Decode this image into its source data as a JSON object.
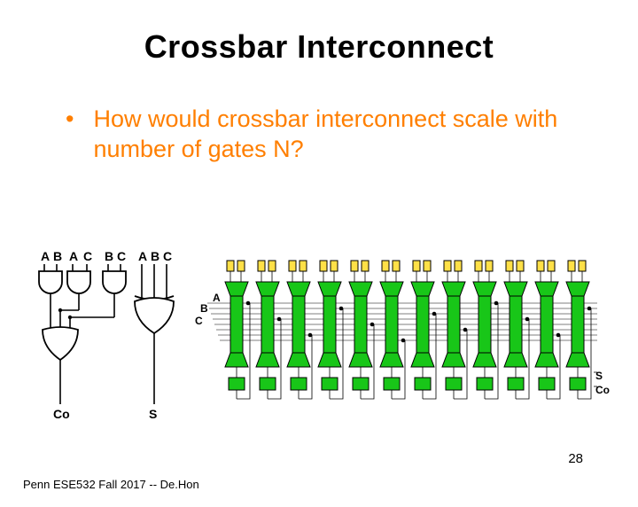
{
  "title": "Crossbar Interconnect",
  "bullet": {
    "text": "How would crossbar interconnect scale with number of gates N?"
  },
  "gate_labels": {
    "top": [
      "A",
      "B",
      "A",
      "C",
      "B",
      "C",
      "A",
      "B",
      "C"
    ],
    "bottom_left": "Co",
    "bottom_right": "S"
  },
  "array_labels": {
    "inputs": [
      "A",
      "B",
      "C"
    ],
    "out_right_top": "S",
    "out_right_bottom": "Co"
  },
  "array": {
    "columns": 12,
    "horizontal_wires": 8
  },
  "footer": "Penn ESE532 Fall 2017 -- De.Hon",
  "page": "28"
}
